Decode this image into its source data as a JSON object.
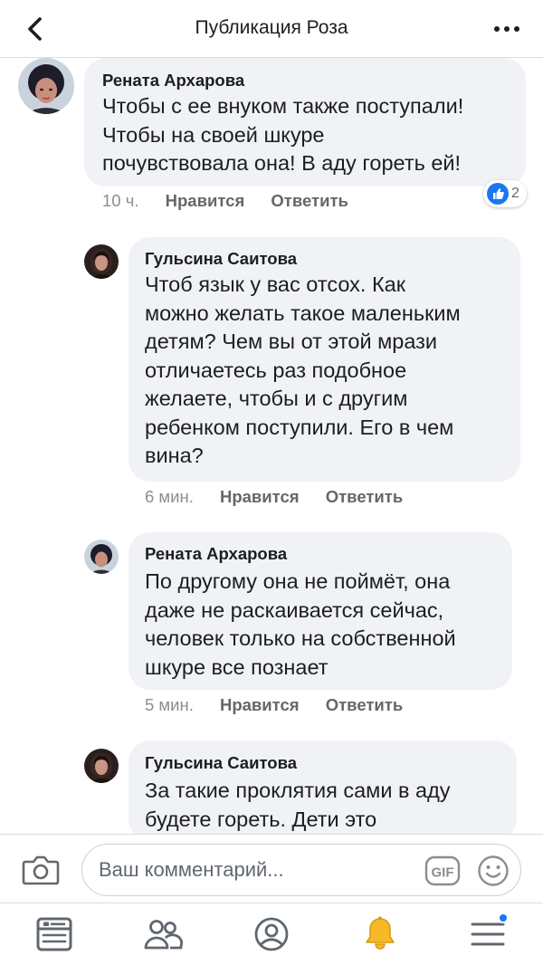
{
  "header": {
    "title": "Публикация Роза"
  },
  "comments": [
    {
      "author": "Рената Архарова",
      "lines": [
        "Чтобы с ее внуком также поступали!",
        "Чтобы на своей шкуре",
        "почувствовала она! В  аду гореть ей!"
      ],
      "time": "10 ч.",
      "like_label": "Нравится",
      "reply_label": "Ответить",
      "reaction_count": "2"
    },
    {
      "author": "Гульсина Саитова",
      "lines": [
        "Чтоб язык у вас отсох. Как",
        "можно желать такое маленьким",
        "детям?  Чем вы от этой мрази",
        "отличаетесь раз подобное",
        "желаете, чтобы и с другим",
        "ребенком поступили. Его в чем",
        "вина?"
      ],
      "time": "6 мин.",
      "like_label": "Нравится",
      "reply_label": "Ответить"
    },
    {
      "author": "Рената Архарова",
      "lines": [
        "По другому она не поймёт, она",
        "даже не раскаивается сейчас,",
        "человек только на собственной",
        "шкуре все познает"
      ],
      "time": "5 мин.",
      "like_label": "Нравится",
      "reply_label": "Ответить"
    },
    {
      "author": "Гульсина Саитова",
      "lines": [
        "За такие проклятия сами в аду",
        "будете гореть. Дети это"
      ]
    }
  ],
  "composer": {
    "placeholder": "Ваш комментарий...",
    "gif_label": "GIF"
  },
  "colors": {
    "accent": "#1877f2",
    "bubble": "#f0f2f5",
    "muted": "#8a8d91",
    "notification": "#f7b928"
  },
  "icons": {
    "back": "chevron-left-icon",
    "more": "more-dots-icon",
    "camera": "camera-icon",
    "gif": "gif-icon",
    "emoji": "emoji-icon",
    "nav": [
      "news-feed-icon",
      "friends-icon",
      "profile-icon",
      "notifications-bell-icon",
      "menu-icon"
    ]
  }
}
